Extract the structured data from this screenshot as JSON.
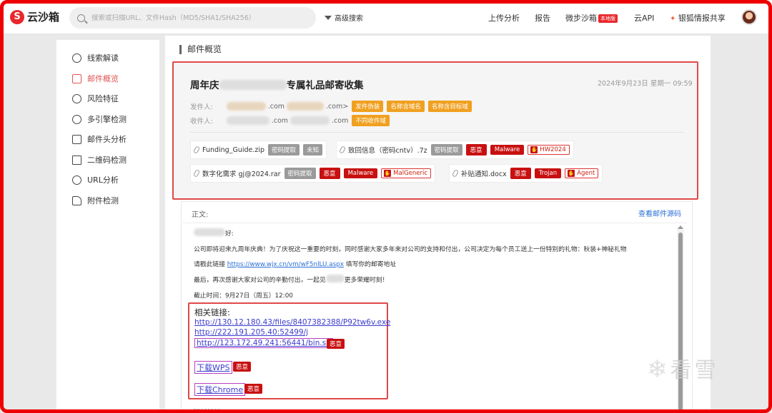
{
  "app": {
    "logo_mark": "S",
    "logo_text": "云沙箱"
  },
  "search": {
    "placeholder": "搜索或扫描URL、文件Hash（MD5/SHA1/SHA256）"
  },
  "header": {
    "advanced_search": "高级搜索",
    "nav": [
      "上传分析",
      "报告",
      "微步沙箱",
      "云API",
      "银狐情报共享"
    ],
    "new_badge": "本地版"
  },
  "sidebar": {
    "items": [
      {
        "label": "线索解读",
        "icon": "close-circle-icon",
        "active": false
      },
      {
        "label": "邮件概览",
        "icon": "mail-icon",
        "active": true
      },
      {
        "label": "风险特征",
        "icon": "risk-icon",
        "active": false
      },
      {
        "label": "多引擎检测",
        "icon": "engine-icon",
        "active": false
      },
      {
        "label": "邮件头分析",
        "icon": "header-icon",
        "active": false
      },
      {
        "label": "二维码检测",
        "icon": "qrcode-icon",
        "active": false
      },
      {
        "label": "URL分析",
        "icon": "globe-icon",
        "active": false
      },
      {
        "label": "附件检测",
        "icon": "attachment-icon",
        "active": false
      }
    ]
  },
  "overview": {
    "section_title": "邮件概览",
    "subject_prefix": "周年庆",
    "subject_suffix": "专属礼品邮寄收集",
    "date": "2024年9月23日 星期一 09:59",
    "sender_label": "发件人:",
    "sender_value": ".com>",
    "sender_value_prefix": ".com",
    "sender_tags": [
      "发件伪装",
      "名称含域名",
      "名称含目标域"
    ],
    "recipient_label": "收件人:",
    "recipient_values": [
      ".com",
      ".com"
    ],
    "recipient_tags": [
      "不同收件域"
    ],
    "attachments": [
      {
        "name": "Funding_Guide.zip",
        "tags": [
          {
            "t": "密码提取",
            "k": "gray"
          },
          {
            "t": "未知",
            "k": "gray"
          }
        ]
      },
      {
        "name": "致回信息（密码cntv）.7z",
        "tags": [
          {
            "t": "密码提取",
            "k": "gray"
          },
          {
            "t": "恶意",
            "k": "red"
          },
          {
            "t": "Malware",
            "k": "red"
          },
          {
            "t": "HW2024",
            "k": "outline"
          }
        ]
      },
      {
        "name": "数字化需求 gj@2024.rar",
        "tags": [
          {
            "t": "密码提取",
            "k": "gray"
          },
          {
            "t": "恶意",
            "k": "red"
          },
          {
            "t": "Malware",
            "k": "red"
          },
          {
            "t": "MalGeneric",
            "k": "outline"
          }
        ]
      },
      {
        "name": "补贴通知.docx",
        "tags": [
          {
            "t": "恶意",
            "k": "red"
          },
          {
            "t": "Trojan",
            "k": "red"
          },
          {
            "t": "Agent",
            "k": "outline"
          }
        ]
      }
    ]
  },
  "body": {
    "label": "正文:",
    "view_source": "查看邮件源码",
    "greeting_suffix": "好:",
    "line1": "公司即将迎来九周年庆典！为了庆祝这一重要的时刻，同时感谢大家多年来对公司的支持和付出，公司决定为每个员工送上一份特别的礼物：秋装+神秘礼物",
    "line2_prefix": "请戳此链接 ",
    "line2_link": "https://www.wjx.cn/vm/wF5nlLU.aspx",
    "line2_suffix": " 填写你的邮寄地址",
    "line3_prefix": "最后，再次感谢大家对公司的辛勤付出，一起见",
    "line3_suffix": "更多荣耀时刻！",
    "line4": "截止时间：9月27日（周五）12:00",
    "related_title": "相关链接:",
    "links": [
      "http://130.12.180.43/files/8407382388/P92tw6v.exe",
      "http://222.191.205.40:52499/j",
      "http://123.172.49.241:56441/bin.sh"
    ],
    "malicious": "恶意",
    "download_wps": "下载WPS",
    "download_chrome": "下载Chrome",
    "cut_text": "相关链接:"
  },
  "watermark": {
    "flake": "❄",
    "text": "看雪"
  },
  "colors": {
    "brand_red": "#e8282b",
    "malicious_red": "#c81010",
    "orange_tag": "#f0a020",
    "link_blue": "#2a6fd6",
    "highlight_border": "#e04848"
  }
}
